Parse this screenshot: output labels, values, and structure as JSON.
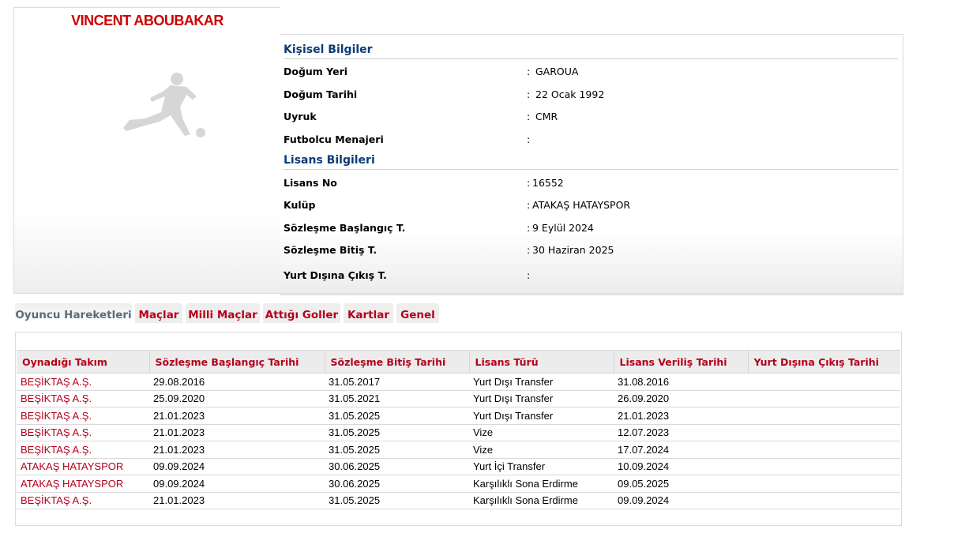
{
  "player": {
    "name": "VINCENT ABOUBAKAR"
  },
  "personal": {
    "title": "Kişisel Bilgiler",
    "colon": ":",
    "fields": [
      {
        "label": "Doğum Yeri",
        "value": "GAROUA"
      },
      {
        "label": "Doğum Tarihi",
        "value": "22 Ocak 1992"
      },
      {
        "label": "Uyruk",
        "value": "CMR"
      },
      {
        "label": "Futbolcu Menajeri",
        "value": ""
      }
    ]
  },
  "license": {
    "title": "Lisans Bilgileri",
    "colon": ":",
    "fields": [
      {
        "label": "Lisans No",
        "value": "16552"
      },
      {
        "label": "Kulüp",
        "value": "ATAKAŞ HATAYSPOR"
      },
      {
        "label": "Sözleşme Başlangıç T.",
        "value": "9 Eylül 2024"
      },
      {
        "label": "Sözleşme Bitiş T.",
        "value": "30 Haziran 2025"
      },
      {
        "label": "Yurt Dışına Çıkış T.",
        "value": ""
      }
    ]
  },
  "tabs": [
    {
      "label": "Oyuncu Hareketleri",
      "active": true
    },
    {
      "label": "Maçlar"
    },
    {
      "label": "Milli Maçlar"
    },
    {
      "label": "Attığı Goller"
    },
    {
      "label": "Kartlar"
    },
    {
      "label": "Genel"
    }
  ],
  "table": {
    "headers": [
      "Oynadığı Takım",
      "Sözleşme Başlangıç Tarihi",
      "Sözleşme Bitiş Tarihi",
      "Lisans Türü",
      "Lisans Veriliş Tarihi",
      "Yurt Dışına Çıkış Tarihi"
    ],
    "rows": [
      [
        "BEŞİKTAŞ A.Ş.",
        "29.08.2016",
        "31.05.2017",
        "Yurt Dışı Transfer",
        "31.08.2016",
        ""
      ],
      [
        "BEŞİKTAŞ A.Ş.",
        "25.09.2020",
        "31.05.2021",
        "Yurt Dışı Transfer",
        "26.09.2020",
        ""
      ],
      [
        "BEŞİKTAŞ A.Ş.",
        "21.01.2023",
        "31.05.2025",
        "Yurt Dışı Transfer",
        "21.01.2023",
        ""
      ],
      [
        "BEŞİKTAŞ A.Ş.",
        "21.01.2023",
        "31.05.2025",
        "Vize",
        "12.07.2023",
        ""
      ],
      [
        "BEŞİKTAŞ A.Ş.",
        "21.01.2023",
        "31.05.2025",
        "Vize",
        "17.07.2024",
        ""
      ],
      [
        "ATAKAŞ HATAYSPOR",
        "09.09.2024",
        "30.06.2025",
        "Yurt İçi Transfer",
        "10.09.2024",
        ""
      ],
      [
        "ATAKAŞ HATAYSPOR",
        "09.09.2024",
        "30.06.2025",
        "Karşılıklı Sona Erdirme",
        "09.05.2025",
        ""
      ],
      [
        "BEŞİKTAŞ A.Ş.",
        "21.01.2023",
        "31.05.2025",
        "Karşılıklı Sona Erdirme",
        "09.09.2024",
        ""
      ]
    ]
  },
  "colors": {
    "accent_red": "#cc0000",
    "link_red": "#b5001a",
    "section_blue": "#0d3c78"
  },
  "icons": {
    "player_image": "footballer-silhouette-icon"
  }
}
